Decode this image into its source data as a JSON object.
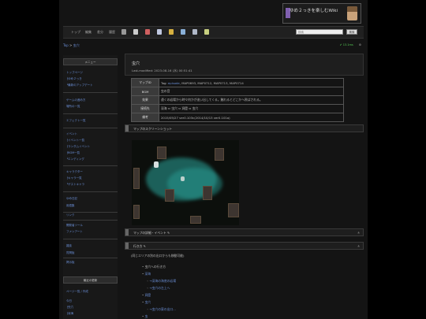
{
  "header": {
    "logo_text": "ゆめ２っきを楽しむWiki"
  },
  "toolbar": {
    "items": [
      "トップ",
      "編集",
      "差分",
      "履歴"
    ],
    "search_placeholder": "検索",
    "search_button": "検索"
  },
  "breadcrumb": {
    "top": "Top",
    "separator": ">",
    "current": "虫穴"
  },
  "status": {
    "text": "13.1ms"
  },
  "sidebar": {
    "menu_heading": "メニュー",
    "links_group1": [
      "トップページ",
      "├ゆめ２っき",
      "└最新のアップデート"
    ],
    "links_group2": [
      "ゲームの進め方",
      "場所の一覧"
    ],
    "links_group3": [
      "エフェクト一覧"
    ],
    "links_group4": [
      "イベント",
      "├イベント一覧",
      "├ランダムイベント",
      "├BGM一覧",
      "└エンディング"
    ],
    "links_group5": [
      "キャラクター",
      "├キャラ一覧",
      "└ゲストキャラ"
    ],
    "links_group6": [
      "ゆめ日記",
      "用語集"
    ],
    "links_group7": [
      "リンク"
    ],
    "links_group8": [
      "開発者ツール",
      "ファンアート"
    ],
    "links_group9": [
      "雑談",
      "質問板"
    ],
    "links_group10": [
      "掲示板"
    ],
    "recent_heading": "最近の更新",
    "recent_links": [
      "ページ一覧 / 作成",
      "今日",
      "├虫穴",
      "├深海"
    ]
  },
  "main": {
    "title": "虫穴",
    "last_modified": "Last-modified: 2023-08-16 (水) 00:51:41",
    "info": [
      {
        "key": "マップID",
        "value_prefix": "Tag: ",
        "value_link": "episode",
        "value_rest": ", MAP0693, MAP0712, MAP0713, MAP0714"
      },
      {
        "key": "BGM",
        "value": "虫の音"
      },
      {
        "key": "効果",
        "value": "遠くの岩場から時々何かが這い出してくる。触れるとどこかへ飛ばされる。"
      },
      {
        "key": "接続先",
        "value": "深海 ⇔ 虫穴 ⇔ 洞窟 ⇔ 虫穴"
      },
      {
        "key": "備考",
        "value": "2015/05/27 ver0.103c(2014/10/13 ver0.101a)"
      }
    ],
    "image_caption": "マップのスクリーンショット",
    "section1": "マップの詳細・イベント",
    "section2": "行き方",
    "section2_intro": "(同じエリアの別の出口からも移動可能)",
    "list": [
      "虫穴への行き方",
      "深海",
      "→深海の海底の岩場",
      "→虫穴の左上へ",
      "洞窟",
      "虫穴",
      "→虫穴の東の出口...",
      "虫"
    ]
  }
}
